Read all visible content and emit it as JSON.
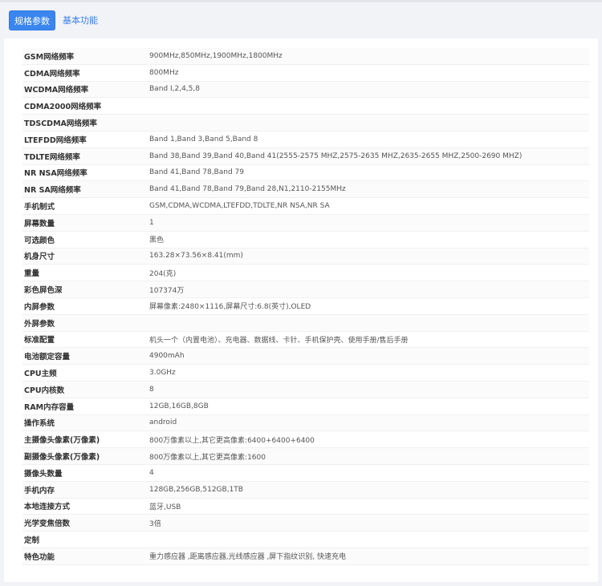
{
  "tabs": [
    {
      "label": "规格参数",
      "active": true
    },
    {
      "label": "基本功能",
      "active": false
    }
  ],
  "specs": [
    {
      "label": "GSM网络频率",
      "value": "900MHz,850MHz,1900MHz,1800MHz"
    },
    {
      "label": "CDMA网络频率",
      "value": "800MHz"
    },
    {
      "label": "WCDMA网络频率",
      "value": "Band Ⅰ,2,4,5,8"
    },
    {
      "label": "CDMA2000网络频率",
      "value": ""
    },
    {
      "label": "TDSCDMA网络频率",
      "value": ""
    },
    {
      "label": "LTEFDD网络频率",
      "value": "Band 1,Band 3,Band 5,Band 8"
    },
    {
      "label": "TDLTE网络频率",
      "value": "Band 38,Band 39,Band 40,Band 41(2555-2575 MHZ,2575-2635 MHZ,2635-2655 MHZ,2500-2690 MHZ)"
    },
    {
      "label": "NR NSA网络频率",
      "value": "Band 41,Band 78,Band 79"
    },
    {
      "label": "NR SA网络频率",
      "value": "Band 41,Band 78,Band 79,Band 28,N1,2110-2155MHz"
    },
    {
      "label": "手机制式",
      "value": "GSM,CDMA,WCDMA,LTEFDD,TDLTE,NR NSA,NR SA"
    },
    {
      "label": "屏幕数量",
      "value": "1"
    },
    {
      "label": "可选颜色",
      "value": "黑色"
    },
    {
      "label": "机身尺寸",
      "value": "163.28×73.56×8.41(mm)"
    },
    {
      "label": "重量",
      "value": "204(克)"
    },
    {
      "label": "彩色屏色深",
      "value": "107374万"
    },
    {
      "label": "内屏参数",
      "value": "屏幕像素:2480×1116,屏幕尺寸:6.8(英寸),OLED"
    },
    {
      "label": "外屏参数",
      "value": ""
    },
    {
      "label": "标准配置",
      "value": "机头一个（内置电池）、充电器、数据线、卡针、手机保护壳、使用手册/售后手册"
    },
    {
      "label": "电池额定容量",
      "value": "4900mAh"
    },
    {
      "label": "CPU主频",
      "value": "3.0GHz"
    },
    {
      "label": "CPU内核数",
      "value": "8"
    },
    {
      "label": "RAM内存容量",
      "value": "12GB,16GB,8GB"
    },
    {
      "label": "操作系统",
      "value": "android"
    },
    {
      "label": "主摄像头像素(万像素)",
      "value": "800万像素以上,其它更高像素:6400+6400+6400"
    },
    {
      "label": "副摄像头像素(万像素)",
      "value": "800万像素以上,其它更高像素:1600"
    },
    {
      "label": "摄像头数量",
      "value": "4"
    },
    {
      "label": "手机内存",
      "value": "128GB,256GB,512GB,1TB"
    },
    {
      "label": "本地连接方式",
      "value": "蓝牙,USB"
    },
    {
      "label": "光学变焦倍数",
      "value": "3倍"
    },
    {
      "label": "定制",
      "value": ""
    },
    {
      "label": "特色功能",
      "value": "重力感应器 ,距离感应器,光线感应器 ,屏下指纹识别, 快速充电"
    }
  ],
  "colors": {
    "accent": "#3a86ee",
    "tab_link": "#3a7ee6",
    "page_bg": "#f2f3f7",
    "panel_bg": "#ffffff"
  }
}
